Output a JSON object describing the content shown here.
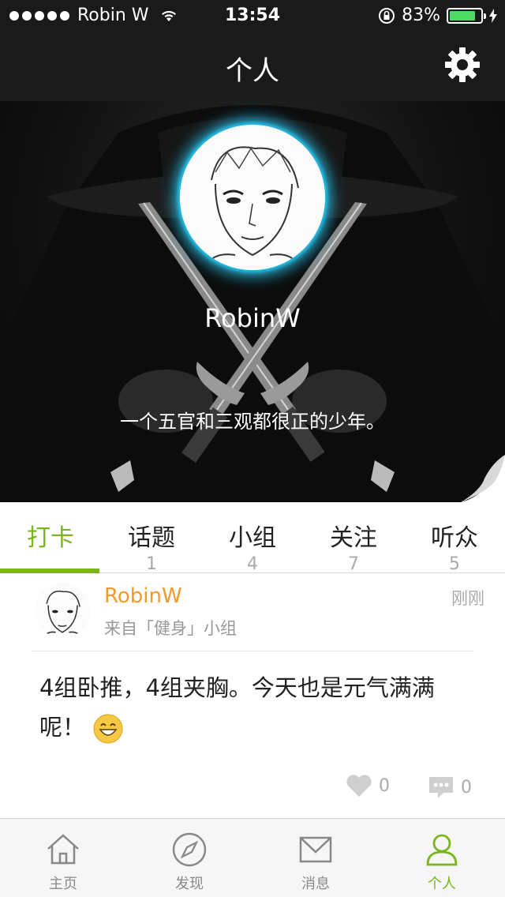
{
  "status_bar": {
    "carrier": "Robin W",
    "time": "13:54",
    "battery": "83%",
    "battery_level": 0.83
  },
  "nav": {
    "title": "个人",
    "settings_icon": "gear-icon"
  },
  "profile": {
    "name": "RobinW",
    "bio": "一个五官和三观都很正的少年。",
    "accent_glow": "#28bee6"
  },
  "tabs": [
    {
      "label": "打卡",
      "count": "",
      "active": true
    },
    {
      "label": "话题",
      "count": "1"
    },
    {
      "label": "小组",
      "count": "4"
    },
    {
      "label": "关注",
      "count": "7"
    },
    {
      "label": "听众",
      "count": "5"
    }
  ],
  "post": {
    "author": "RobinW",
    "source": "来自「健身」小组",
    "time": "刚刚",
    "content": "4组卧推，4组夹胸。今天也是元气满满呢！",
    "likes": "0",
    "comments": "0"
  },
  "tabbar": [
    {
      "label": "主页",
      "icon": "home-icon"
    },
    {
      "label": "发现",
      "icon": "compass-icon"
    },
    {
      "label": "消息",
      "icon": "mail-icon"
    },
    {
      "label": "个人",
      "icon": "person-icon",
      "active": true
    }
  ],
  "colors": {
    "accent_green": "#7ab51d",
    "author_orange": "#f19a2d",
    "battery_green": "#4cd964"
  }
}
